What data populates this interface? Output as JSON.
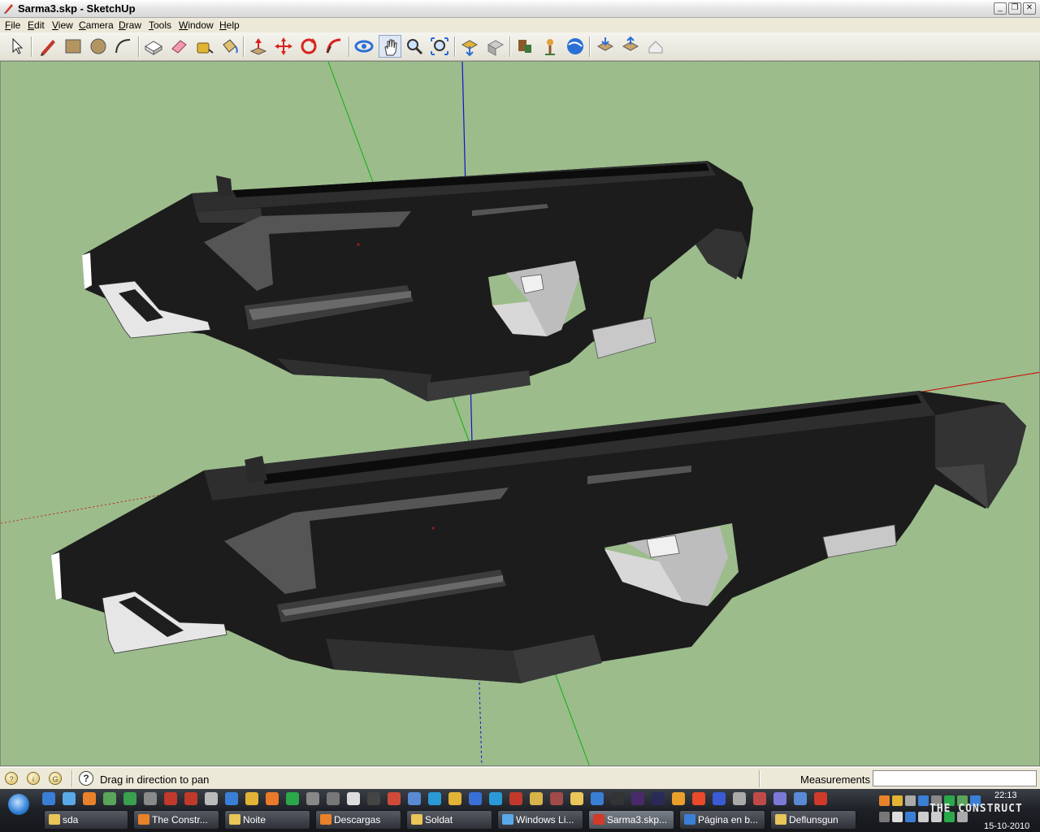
{
  "window": {
    "title": "Sarma3.skp - SketchUp"
  },
  "menu": [
    {
      "label": "File",
      "access": "F",
      "rest": "ile"
    },
    {
      "label": "Edit",
      "access": "E",
      "rest": "dit"
    },
    {
      "label": "View",
      "access": "V",
      "rest": "iew"
    },
    {
      "label": "Camera",
      "access": "C",
      "rest": "amera"
    },
    {
      "label": "Draw",
      "access": "D",
      "rest": "raw"
    },
    {
      "label": "Tools",
      "access": "T",
      "rest": "ools"
    },
    {
      "label": "Window",
      "access": "W",
      "rest": "indow"
    },
    {
      "label": "Help",
      "access": "H",
      "rest": "elp"
    }
  ],
  "toolbar": {
    "tools": [
      "select",
      "pencil",
      "rectangle",
      "circle",
      "arc",
      "make-component",
      "eraser",
      "tape-measure",
      "paint-bucket",
      "push-pull",
      "move",
      "rotate",
      "follow-me",
      "orbit",
      "pan",
      "zoom",
      "zoom-extents",
      "get-models",
      "share-model",
      "components",
      "add-location",
      "toggle-terrain",
      "google-earth",
      "get-models-2",
      "share-model-2",
      "model-info"
    ],
    "active_tool": "pan"
  },
  "status": {
    "hint": "Drag in direction to pan",
    "measurements_label": "Measurements",
    "measurements_value": ""
  },
  "colors": {
    "sky": "#9cbc8c",
    "model_dark": "#1b1b1b",
    "model_mid": "#404040",
    "model_light": "#8a8a8a",
    "axis_red": "#cc0000",
    "axis_green": "#00b000",
    "axis_blue": "#0000cc"
  },
  "taskbar": {
    "items": [
      {
        "label": "sda",
        "icon": "folder-icon"
      },
      {
        "label": "The Constr...",
        "icon": "firefox-icon"
      },
      {
        "label": "Noite",
        "icon": "folder-icon"
      },
      {
        "label": "Descargas",
        "icon": "firefox-icon"
      },
      {
        "label": "Soldat",
        "icon": "folder-icon"
      },
      {
        "label": "Windows Li...",
        "icon": "messenger-icon"
      },
      {
        "label": "Sarma3.skp...",
        "icon": "sketchup-icon",
        "active": true
      },
      {
        "label": "Página en b...",
        "icon": "ie-icon"
      },
      {
        "label": "Deflunsgun",
        "icon": "folder-icon"
      }
    ],
    "time": "22:13",
    "date": "15-10-2010",
    "watermark": "THE CONSTRUCT"
  }
}
